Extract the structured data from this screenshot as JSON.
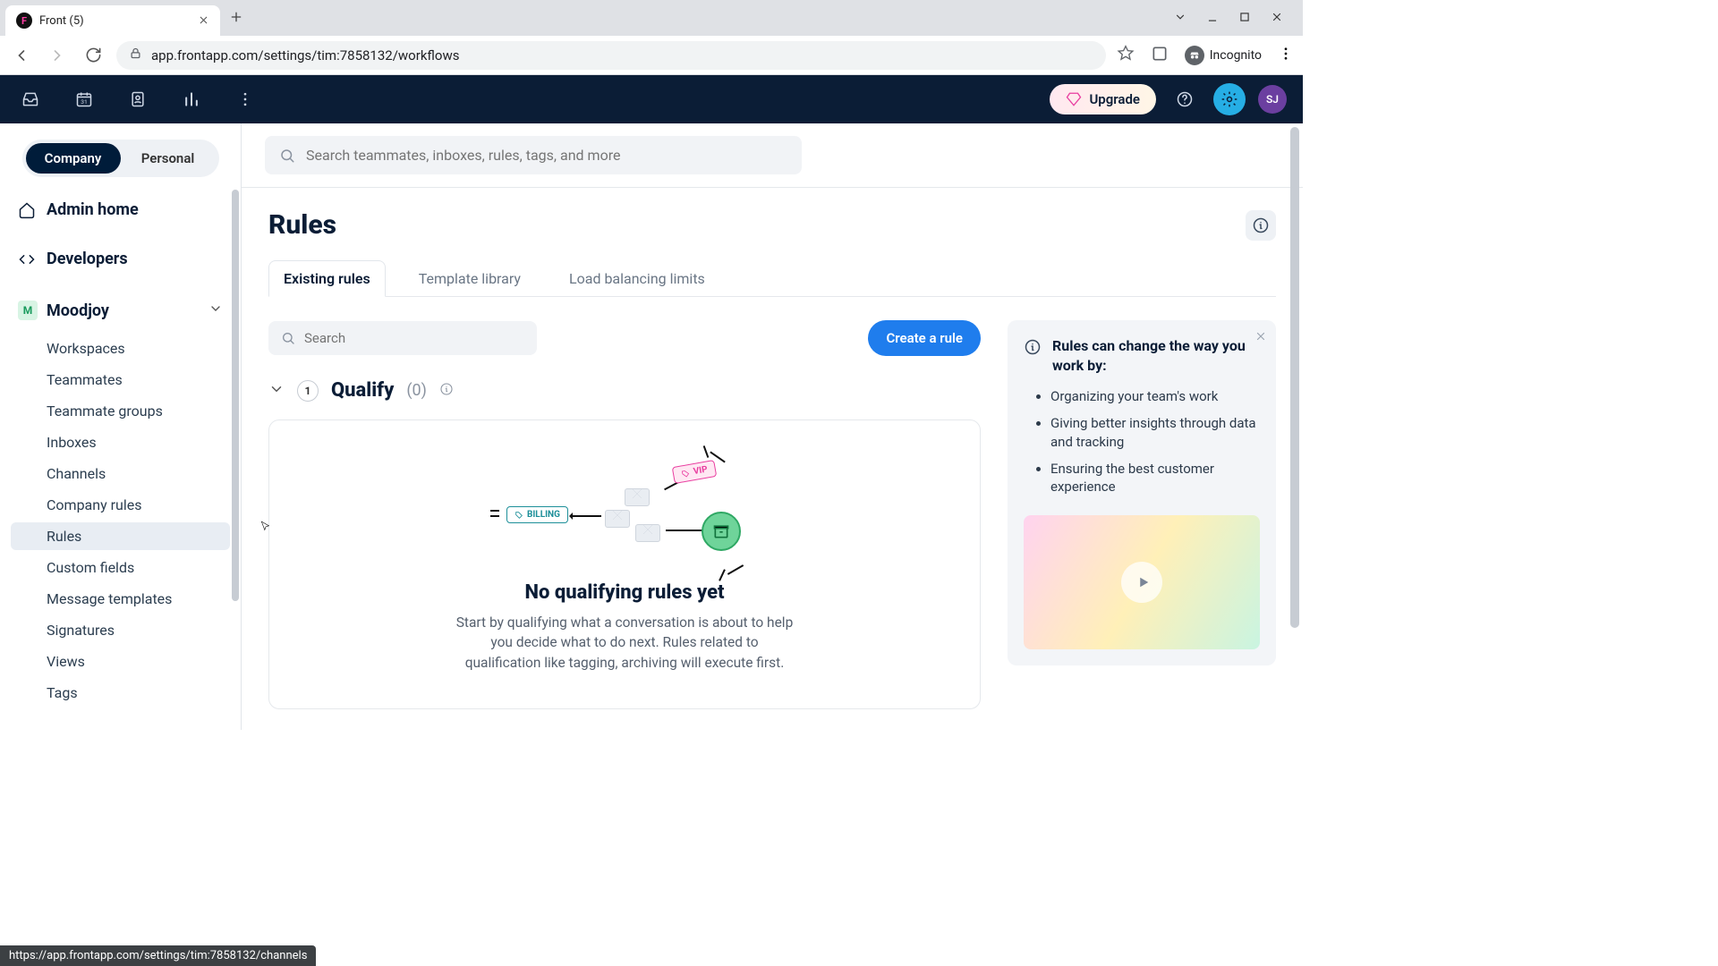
{
  "browser": {
    "tab_title": "Front (5)",
    "url": "app.frontapp.com/settings/tim:7858132/workflows",
    "incognito_label": "Incognito",
    "status_url": "https://app.frontapp.com/settings/tim:7858132/channels"
  },
  "topbar": {
    "upgrade": "Upgrade",
    "avatar_initials": "SJ"
  },
  "sidebar": {
    "scope_tabs": {
      "company": "Company",
      "personal": "Personal"
    },
    "admin_home": "Admin home",
    "developers": "Developers",
    "workspace": {
      "badge": "M",
      "name": "Moodjoy"
    },
    "items": [
      {
        "label": "Workspaces"
      },
      {
        "label": "Teammates"
      },
      {
        "label": "Teammate groups"
      },
      {
        "label": "Inboxes"
      },
      {
        "label": "Channels"
      },
      {
        "label": "Company rules"
      },
      {
        "label": "Rules"
      },
      {
        "label": "Custom fields"
      },
      {
        "label": "Message templates"
      },
      {
        "label": "Signatures"
      },
      {
        "label": "Views"
      },
      {
        "label": "Tags"
      }
    ]
  },
  "search": {
    "placeholder": "Search teammates, inboxes, rules, tags, and more"
  },
  "page": {
    "title": "Rules",
    "tabs": [
      {
        "label": "Existing rules",
        "selected": true
      },
      {
        "label": "Template library",
        "selected": false
      },
      {
        "label": "Load balancing limits",
        "selected": false
      }
    ],
    "filter_placeholder": "Search",
    "create_btn": "Create a rule",
    "section": {
      "index": "1",
      "title": "Qualify",
      "count": "(0)"
    },
    "empty": {
      "tag_billing": "BILLING",
      "tag_vip": "VIP",
      "title": "No qualifying rules yet",
      "desc": "Start by qualifying what a conversation is about to help you decide what to do next. Rules related to qualification like tagging, archiving will execute first."
    }
  },
  "info_panel": {
    "title": "Rules can change the way you work by:",
    "bullets": [
      "Organizing your team's work",
      "Giving better insights through data and tracking",
      "Ensuring the best customer experience"
    ]
  }
}
